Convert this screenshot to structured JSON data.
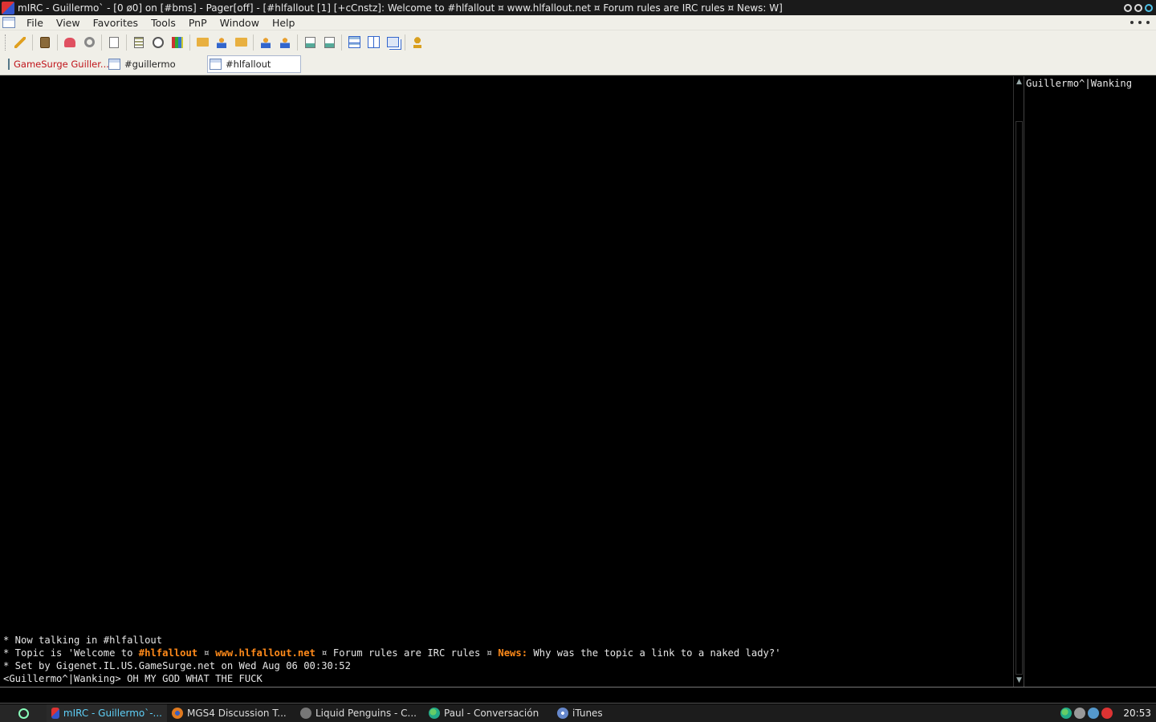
{
  "window": {
    "title": "mIRC - Guillermo` - [0 ø0] on [#bms] - Pager[off] - [#hlfallout [1] [+cCnstz]: Welcome to #hlfallout ¤ www.hlfallout.net ¤ Forum rules are IRC rules ¤ News: W]"
  },
  "menu": {
    "items": [
      "File",
      "View",
      "Favorites",
      "Tools",
      "PnP",
      "Window",
      "Help"
    ]
  },
  "toolbar": {
    "icons": [
      "connect-icon",
      "options-icon",
      "favorites-icon",
      "organize-icon",
      "channels-list-icon",
      "address-book-icon",
      "timer-icon",
      "colors-icon",
      "dcc-send-icon",
      "dcc-chat-icon",
      "scripts-icon",
      "notify-icon",
      "urls-icon",
      "received-icon",
      "log-icon",
      "tile-horizontal-icon",
      "tile-vertical-icon",
      "cascade-icon",
      "help-icon"
    ]
  },
  "switchbar": {
    "tabs": [
      {
        "label": "GameSurge Guiller...",
        "kind": "status"
      },
      {
        "label": "#guillermo",
        "kind": "channel"
      },
      {
        "label": "#hlfallout",
        "kind": "channel",
        "active": true
      }
    ]
  },
  "chat": {
    "line1": "* Now talking in #hlfallout",
    "line2": {
      "prefix": "* Topic is 'Welcome to ",
      "channel": "#hlfallout",
      "sep1": " ¤ ",
      "site": "www.hlfallout.net",
      "mid": " ¤ Forum rules are IRC rules ¤ ",
      "news_label": "News:",
      "news_text": " Why was the topic a link to a naked lady?'"
    },
    "line3": "* Set by Gigenet.IL.US.GameSurge.net on Wed Aug 06 00:30:52",
    "line4": "<Guillermo^|Wanking> OH MY GOD WHAT THE FUCK",
    "accent_color": "#ff8a1a"
  },
  "nicklist": {
    "nicks": [
      "Guillermo^|Wanking"
    ]
  },
  "editbox": {
    "value": ""
  },
  "taskbar": {
    "tasks": [
      {
        "label": "mIRC - Guillermo`-...",
        "icon": "mirc-icon",
        "active": true
      },
      {
        "label": "MGS4 Discussion T...",
        "icon": "firefox-icon",
        "active": false
      },
      {
        "label": "Liquid Penguins - C...",
        "icon": "steam-icon",
        "active": false
      },
      {
        "label": "Paul - Conversación",
        "icon": "messenger-icon",
        "active": false
      },
      {
        "label": "iTunes",
        "icon": "itunes-icon",
        "active": false
      }
    ],
    "clock": "20:53"
  }
}
